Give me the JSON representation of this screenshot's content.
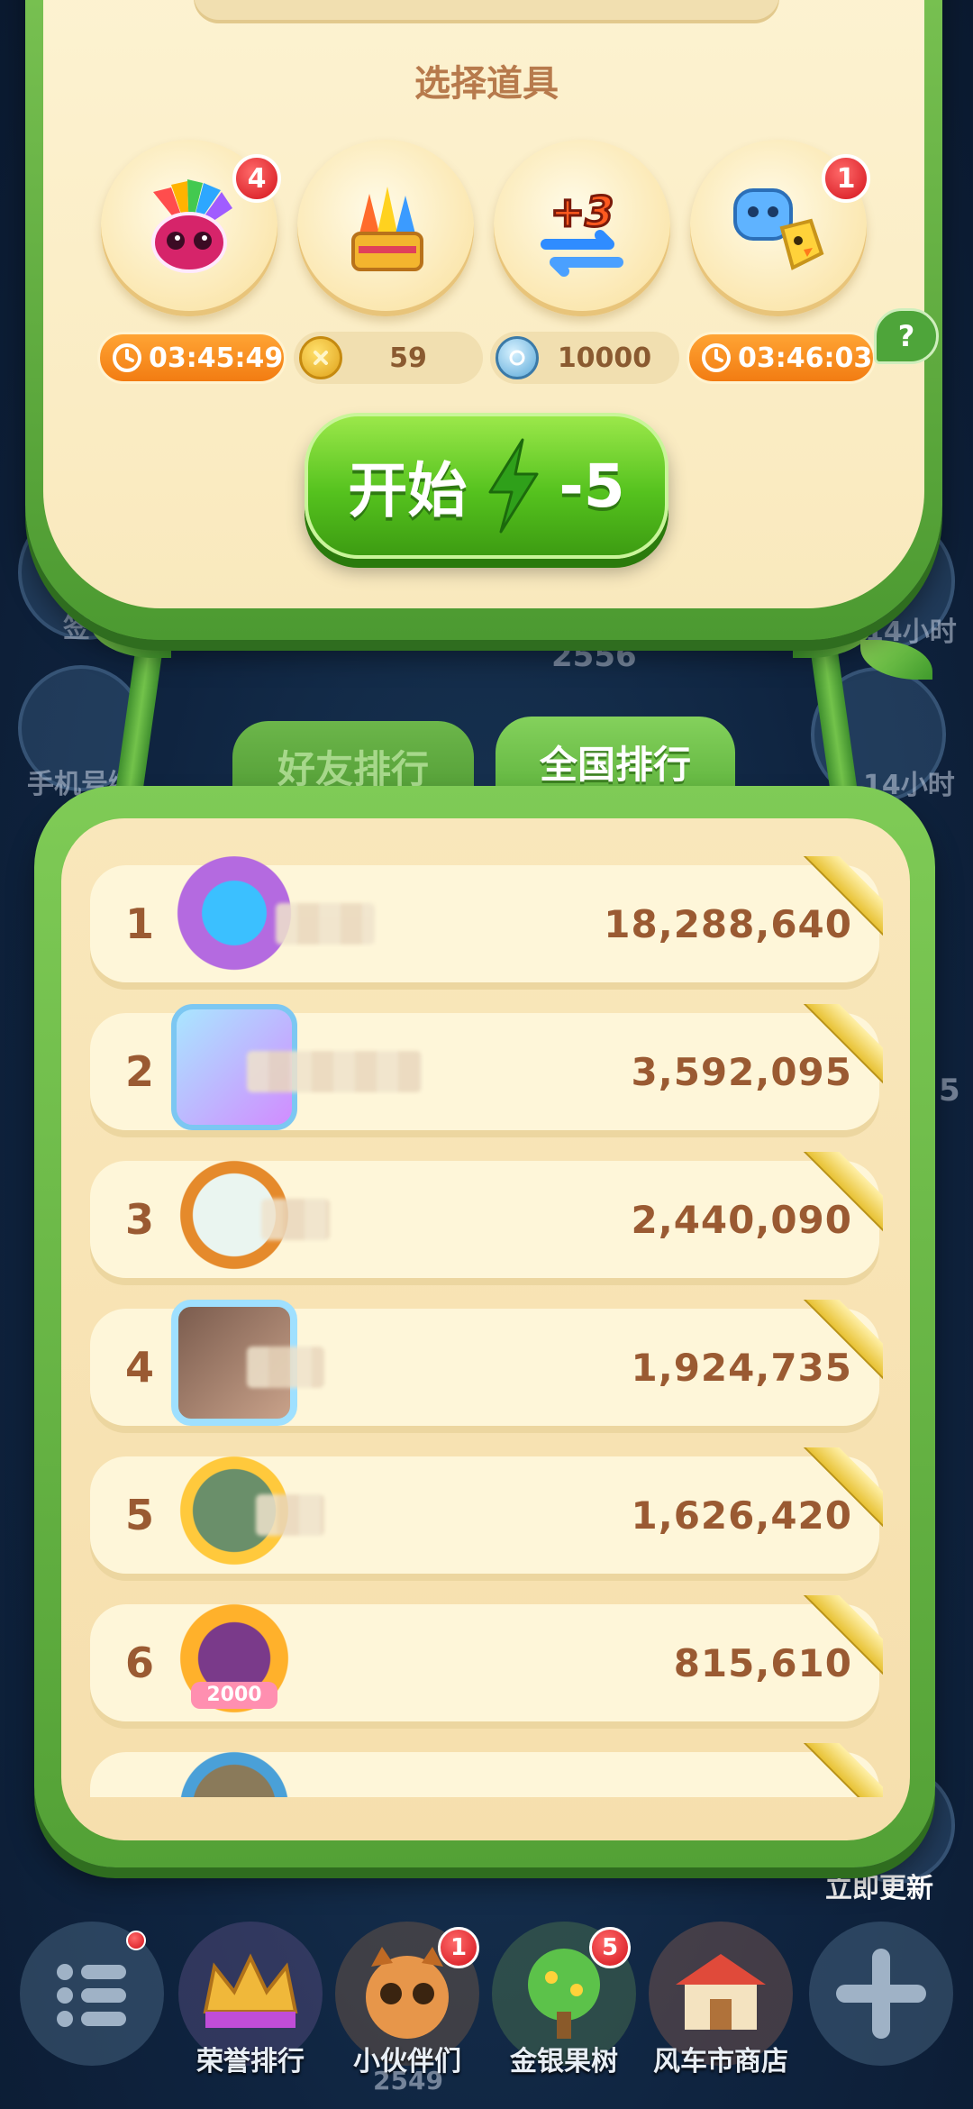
{
  "item_section": {
    "title": "选择道具",
    "items": [
      {
        "name": "owl-booster-icon",
        "badge": "4",
        "timer": "03:45:49"
      },
      {
        "name": "firework-booster-icon",
        "coin_cost": "59"
      },
      {
        "name": "plus-three-moves-icon",
        "label": "+3",
        "gem_cost": "10000"
      },
      {
        "name": "animal-swap-booster-icon",
        "badge": "1",
        "timer": "03:46:03"
      }
    ],
    "help_label": "?"
  },
  "start_button": {
    "label": "开始",
    "energy_cost": "-5"
  },
  "tabs": {
    "friends": "好友排行",
    "national": "全国排行"
  },
  "ranking": [
    {
      "rank": "1",
      "score": "18,288,640"
    },
    {
      "rank": "2",
      "score": "3,592,095"
    },
    {
      "rank": "3",
      "score": "2,440,090"
    },
    {
      "rank": "4",
      "score": "1,924,735"
    },
    {
      "rank": "5",
      "score": "1,626,420"
    },
    {
      "rank": "6",
      "score": "815,610",
      "avatar_label": "2000"
    }
  ],
  "background": {
    "left_labels": [
      "签",
      "手机号绑"
    ],
    "right_labels": [
      "14小时",
      "14小时",
      "立即更新"
    ],
    "center_number": "2556",
    "side_digit": "5"
  },
  "bottom_nav": [
    {
      "label": "",
      "badge": "",
      "icon": "menu-icon"
    },
    {
      "label": "荣誉排行",
      "badge": "",
      "icon": "crown-icon"
    },
    {
      "label": "小伙伴们",
      "badge": "1",
      "icon": "raccoon-icon",
      "sub": "2549"
    },
    {
      "label": "金银果树",
      "badge": "5",
      "icon": "tree-icon"
    },
    {
      "label": "风车市商店",
      "badge": "",
      "icon": "shop-icon"
    },
    {
      "label": "",
      "badge": "",
      "icon": "plus-icon"
    }
  ],
  "colors": {
    "accent_green": "#55c21e",
    "timer_orange": "#f27c12",
    "panel_cream": "#fdf3d2",
    "badge_red": "#d3121b"
  }
}
